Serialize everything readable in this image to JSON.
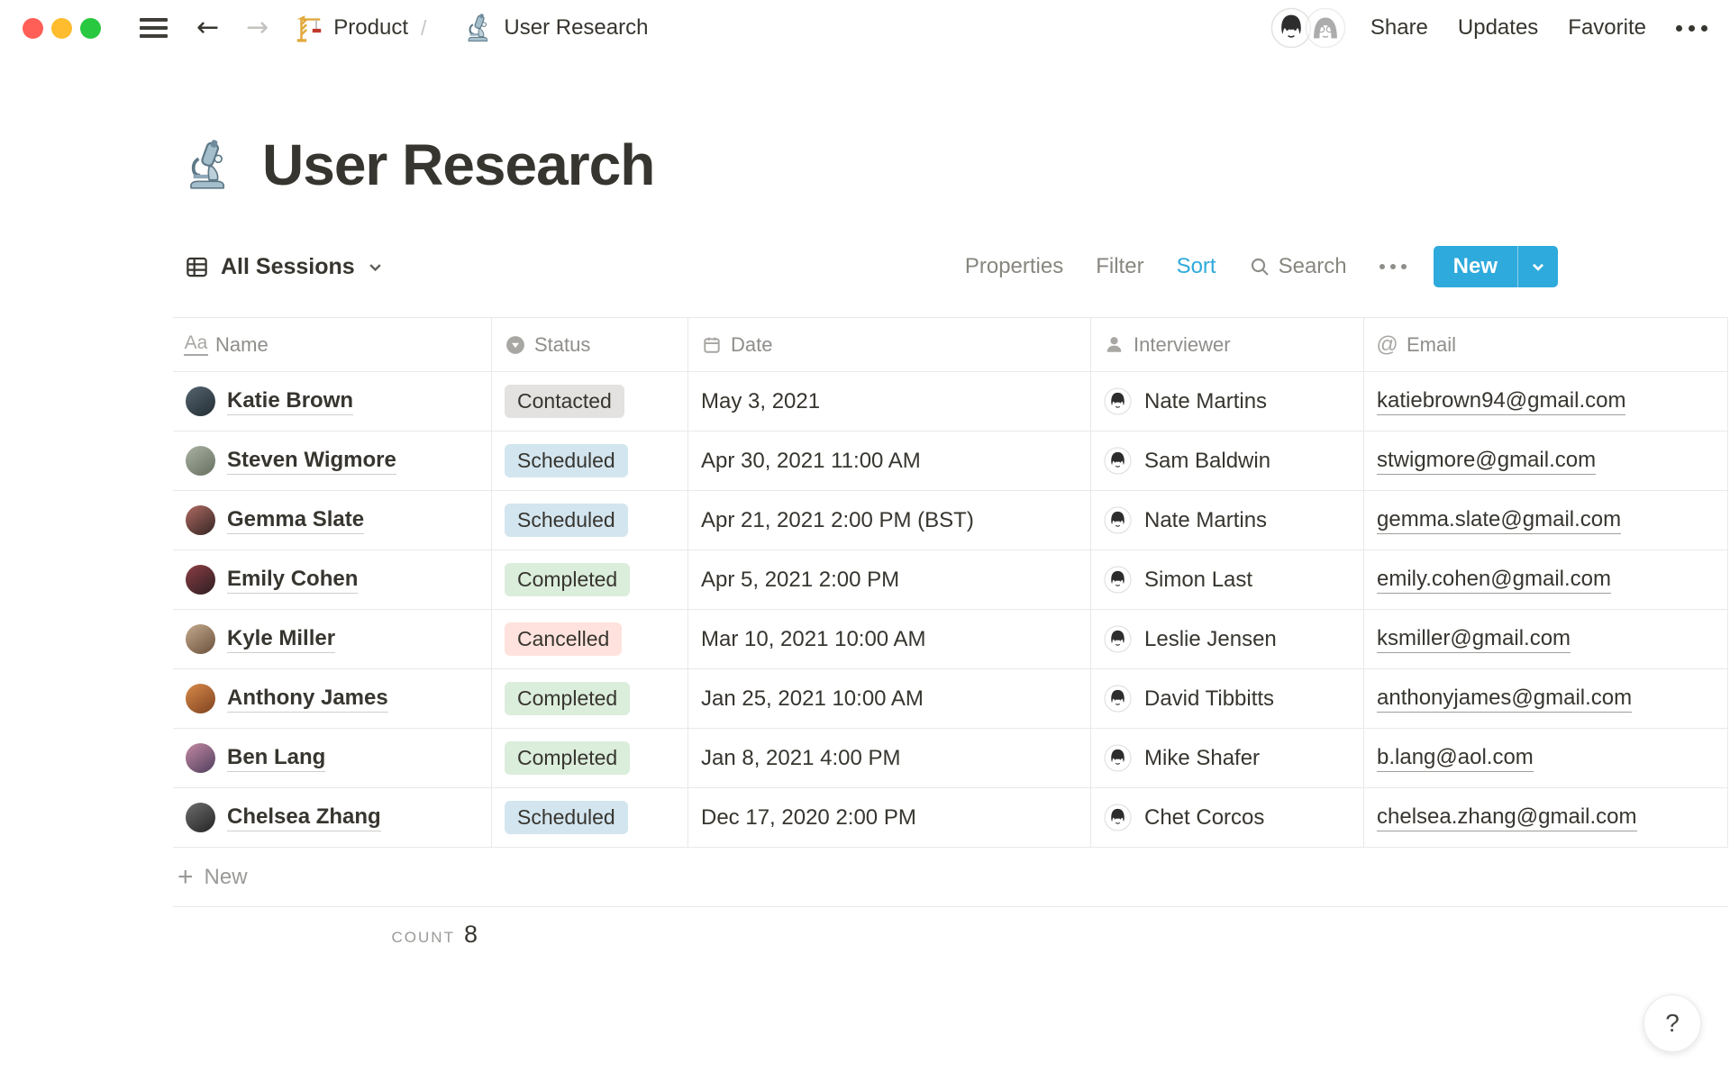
{
  "window": {
    "traffic_lights": {
      "close": "#ff5f57",
      "minimize": "#febc2e",
      "zoom": "#28c840"
    }
  },
  "breadcrumb": {
    "separator": "/",
    "items": [
      {
        "label": "Product",
        "icon": "crane-icon"
      },
      {
        "label": "User Research",
        "icon": "microscope-icon"
      }
    ]
  },
  "topbar_actions": {
    "share": "Share",
    "updates": "Updates",
    "favorite": "Favorite",
    "more": "•••"
  },
  "page": {
    "title": "User Research",
    "icon": "microscope-icon"
  },
  "viewbar": {
    "view_name": "All Sessions",
    "properties": "Properties",
    "filter": "Filter",
    "sort": "Sort",
    "search": "Search",
    "new": "New",
    "accent_blue": "#2eaadc"
  },
  "table": {
    "columns": [
      {
        "label": "Name",
        "icon": "text-icon"
      },
      {
        "label": "Status",
        "icon": "select-icon"
      },
      {
        "label": "Date",
        "icon": "calendar-icon"
      },
      {
        "label": "Interviewer",
        "icon": "person-icon"
      },
      {
        "label": "Email",
        "icon": "at-icon"
      }
    ],
    "status_colors": {
      "gray": "#e3e2e0",
      "blue": "#d3e5ef",
      "green": "#dbeddb",
      "red": "#ffe2dd"
    },
    "rows": [
      {
        "name": "Katie Brown",
        "status": "Contacted",
        "status_color": "gray",
        "date": "May 3, 2021",
        "interviewer": "Nate Martins",
        "email": "katiebrown94@gmail.com",
        "avatar_colors": [
          "#55646f",
          "#232d33"
        ]
      },
      {
        "name": "Steven Wigmore",
        "status": "Scheduled",
        "status_color": "blue",
        "date": "Apr 30, 2021 11:00 AM",
        "interviewer": "Sam Baldwin",
        "email": "stwigmore@gmail.com",
        "avatar_colors": [
          "#a9b2a3",
          "#66705f"
        ]
      },
      {
        "name": "Gemma Slate",
        "status": "Scheduled",
        "status_color": "blue",
        "date": "Apr 21, 2021 2:00 PM (BST)",
        "interviewer": "Nate Martins",
        "email": "gemma.slate@gmail.com",
        "avatar_colors": [
          "#b06a62",
          "#332523"
        ]
      },
      {
        "name": "Emily Cohen",
        "status": "Completed",
        "status_color": "green",
        "date": "Apr 5, 2021 2:00 PM",
        "interviewer": "Simon Last",
        "email": "emily.cohen@gmail.com",
        "avatar_colors": [
          "#8c3e44",
          "#2c1e22"
        ]
      },
      {
        "name": "Kyle Miller",
        "status": "Cancelled",
        "status_color": "red",
        "date": "Mar 10, 2021 10:00 AM",
        "interviewer": "Leslie Jensen",
        "email": "ksmiller@gmail.com",
        "avatar_colors": [
          "#c3a98c",
          "#6b513c"
        ]
      },
      {
        "name": "Anthony James",
        "status": "Completed",
        "status_color": "green",
        "date": "Jan 25, 2021 10:00 AM",
        "interviewer": "David Tibbitts",
        "email": "anthonyjames@gmail.com",
        "avatar_colors": [
          "#d98a4a",
          "#7e421f"
        ]
      },
      {
        "name": "Ben Lang",
        "status": "Completed",
        "status_color": "green",
        "date": "Jan 8, 2021 4:00 PM",
        "interviewer": "Mike Shafer",
        "email": "b.lang@aol.com",
        "avatar_colors": [
          "#c489a2",
          "#4f3f5e"
        ]
      },
      {
        "name": "Chelsea Zhang",
        "status": "Scheduled",
        "status_color": "blue",
        "date": "Dec 17, 2020 2:00 PM",
        "interviewer": "Chet Corcos",
        "email": "chelsea.zhang@gmail.com",
        "avatar_colors": [
          "#6d6d6d",
          "#242424"
        ]
      }
    ],
    "new_row_label": "New",
    "footer": {
      "count_label": "COUNT",
      "count_value": "8"
    }
  },
  "help": {
    "label": "?"
  }
}
